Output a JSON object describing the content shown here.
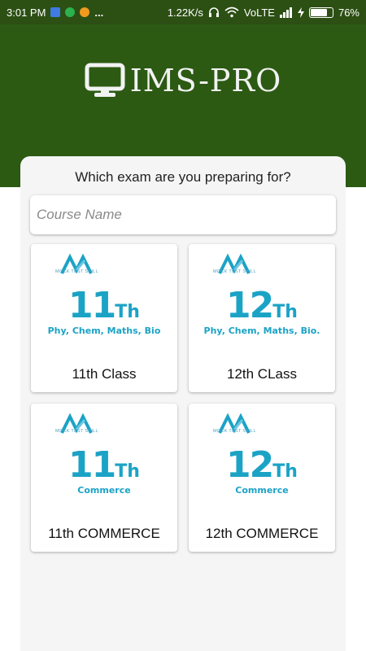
{
  "status_bar": {
    "time": "3:01 PM",
    "more": "...",
    "speed": "1.22K/s",
    "network": "VoLTE",
    "battery_level": 0.76,
    "battery_text": "76%"
  },
  "header": {
    "brand": "IMS-PRO",
    "color": "#2c5a13"
  },
  "main": {
    "question": "Which exam are you preparing for?",
    "search_placeholder": "Course Name",
    "courses": [
      {
        "logo_text": "MOCK TEST SKILL",
        "grade_num": "11",
        "grade_suffix": "Th",
        "subjects": "Phy, Chem, Maths, Bio",
        "label": "11th Class"
      },
      {
        "logo_text": "MOCK TEST SKILL",
        "grade_num": "12",
        "grade_suffix": "Th",
        "subjects": "Phy, Chem, Maths, Bio.",
        "label": "12th CLass"
      },
      {
        "logo_text": "MOCK TEST SKILL",
        "grade_num": "11",
        "grade_suffix": "Th",
        "subjects": "Commerce",
        "label": "11th COMMERCE"
      },
      {
        "logo_text": "MOCK TEST SKILL",
        "grade_num": "12",
        "grade_suffix": "Th",
        "subjects": "Commerce",
        "label": "12th COMMERCE"
      }
    ]
  },
  "colors": {
    "accent": "#1ba3c6",
    "header": "#2c5a13",
    "status_bar": "#2c4f14"
  },
  "icons": [
    "usb-icon",
    "whatsapp-icon",
    "message-icon",
    "headphones-icon",
    "wifi-icon",
    "signal-icon",
    "charging-icon",
    "battery-icon",
    "monitor-icon",
    "mock-test-skill-logo"
  ]
}
